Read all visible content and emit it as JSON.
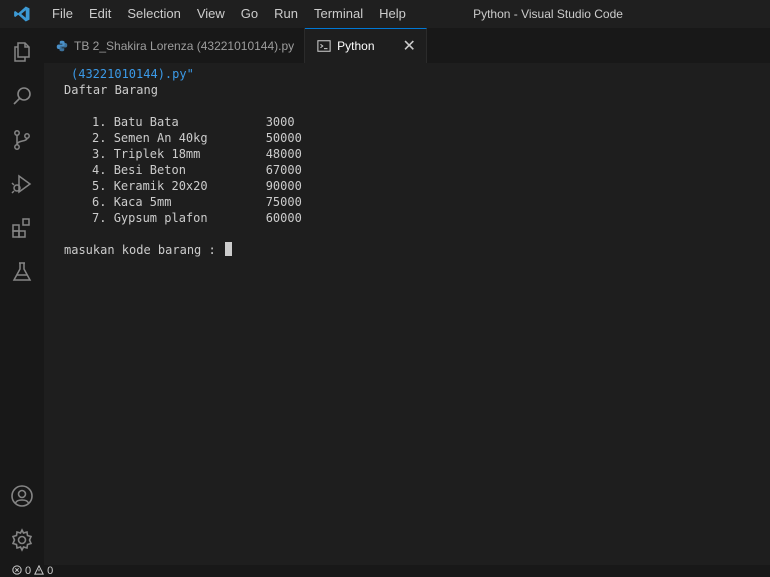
{
  "window": {
    "title": "Python - Visual Studio Code"
  },
  "menu": [
    "File",
    "Edit",
    "Selection",
    "View",
    "Go",
    "Run",
    "Terminal",
    "Help"
  ],
  "tabs": [
    {
      "label": "TB 2_Shakira Lorenza (43221010144).py",
      "icon": "python-file-icon",
      "active": false
    },
    {
      "label": "Python",
      "icon": "terminal-icon",
      "active": true,
      "close": "✕"
    }
  ],
  "terminal": {
    "path_tail": "(43221010144).py\"",
    "heading": "Daftar Barang",
    "items": [
      {
        "no": "1.",
        "name": "Batu Bata",
        "price": "3000"
      },
      {
        "no": "2.",
        "name": "Semen An 40kg",
        "price": "50000"
      },
      {
        "no": "3.",
        "name": "Triplek 18mm",
        "price": "48000"
      },
      {
        "no": "4.",
        "name": "Besi Beton",
        "price": "67000"
      },
      {
        "no": "5.",
        "name": "Keramik 20x20",
        "price": "90000"
      },
      {
        "no": "6.",
        "name": "Kaca 5mm",
        "price": "75000"
      },
      {
        "no": "7.",
        "name": "Gypsum plafon",
        "price": "60000"
      }
    ],
    "prompt": "masukan kode barang : "
  },
  "status": {
    "errors": "0",
    "warnings": "0"
  },
  "colors": {
    "accent": "#0078d4",
    "path_text": "#3b9ae8",
    "background": "#1e1e1e"
  },
  "activity_icons": [
    "explorer-icon",
    "search-icon",
    "source-control-icon",
    "run-debug-icon",
    "extensions-icon",
    "testing-icon",
    "account-icon",
    "settings-gear-icon"
  ]
}
